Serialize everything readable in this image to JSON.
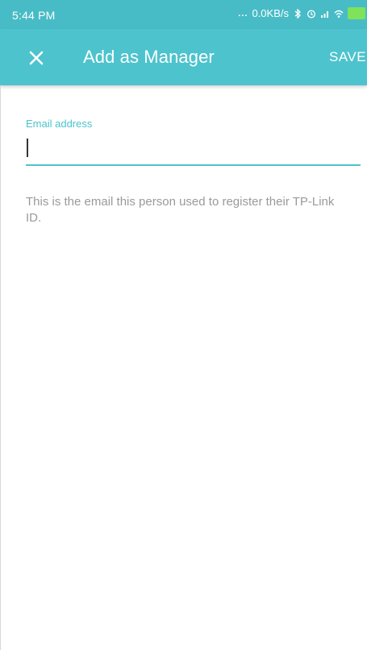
{
  "status_bar": {
    "time": "5:44 PM",
    "network_speed": "0.0KB/s",
    "dots": "...",
    "icons": [
      "bluetooth-icon",
      "alarm-icon",
      "signal-icon",
      "wifi-icon",
      "battery-icon"
    ]
  },
  "app_bar": {
    "title": "Add as Manager",
    "close_icon": "close-icon",
    "save_label": "SAVE"
  },
  "form": {
    "email_label": "Email address",
    "email_value": "",
    "helper_text": "This is the email this person used to register their TP-Link ID."
  },
  "colors": {
    "accent": "#4dc3cd",
    "status_bar": "#48bcc6",
    "helper_text": "#9a9a9a"
  }
}
